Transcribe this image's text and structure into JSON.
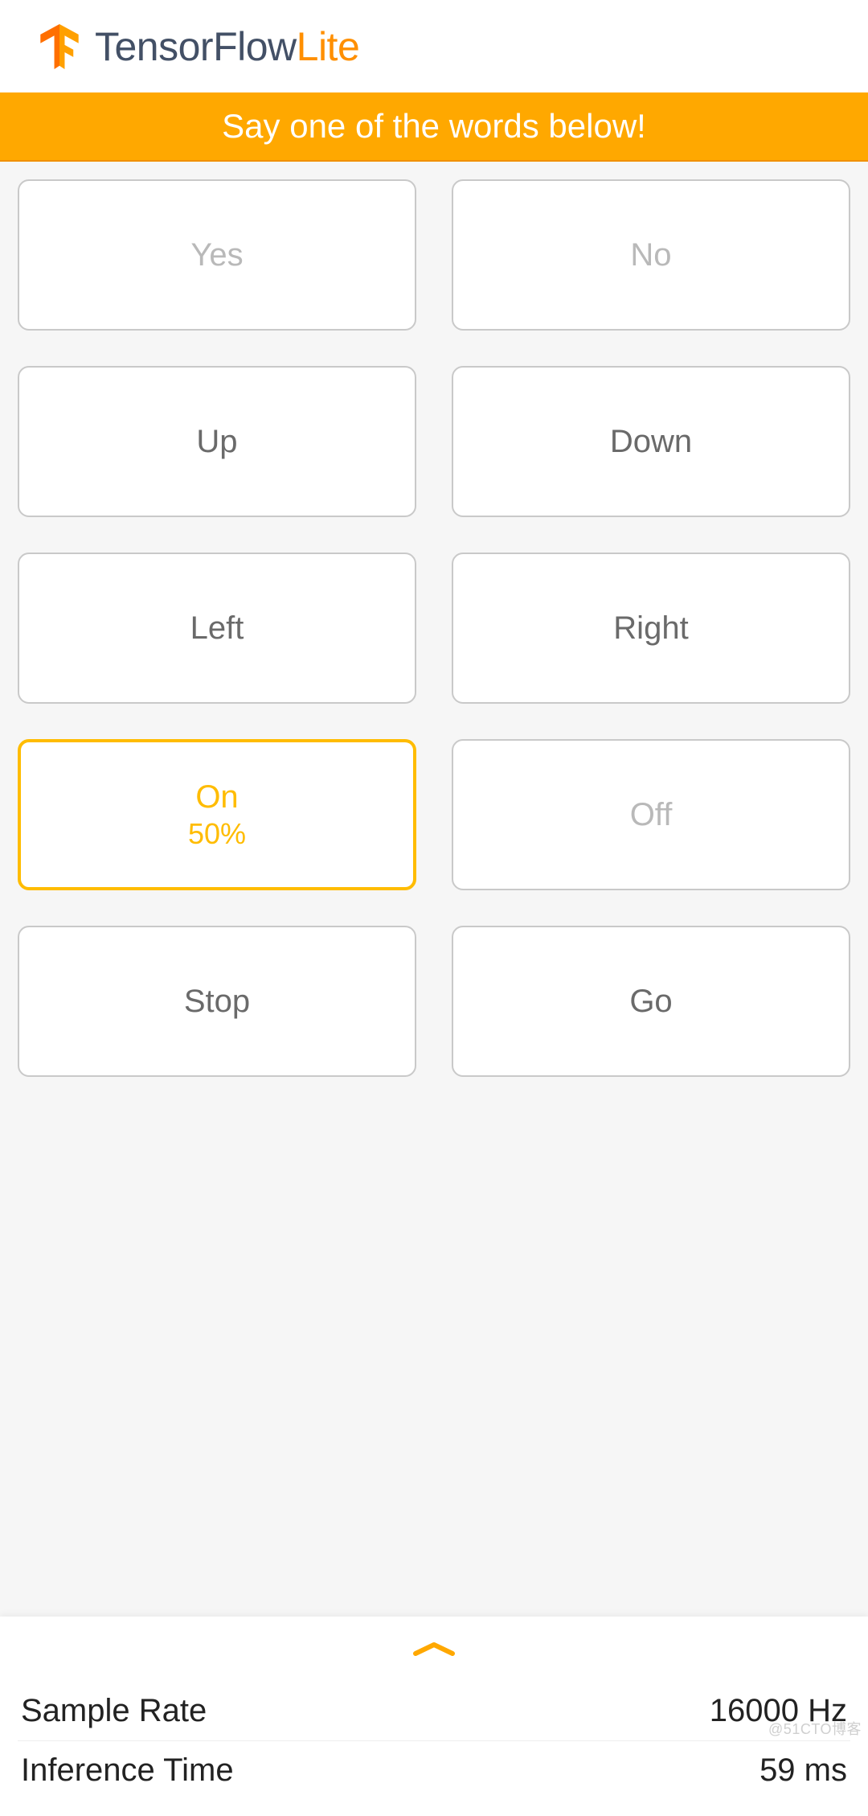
{
  "header": {
    "brand_main": "TensorFlow",
    "brand_sub": "Lite"
  },
  "banner": {
    "text": "Say one of the words below!"
  },
  "words": [
    {
      "label": "Yes",
      "highlighted": false,
      "dim": true,
      "confidence": null
    },
    {
      "label": "No",
      "highlighted": false,
      "dim": true,
      "confidence": null
    },
    {
      "label": "Up",
      "highlighted": false,
      "dim": false,
      "confidence": null
    },
    {
      "label": "Down",
      "highlighted": false,
      "dim": false,
      "confidence": null
    },
    {
      "label": "Left",
      "highlighted": false,
      "dim": false,
      "confidence": null
    },
    {
      "label": "Right",
      "highlighted": false,
      "dim": false,
      "confidence": null
    },
    {
      "label": "On",
      "highlighted": true,
      "dim": false,
      "confidence": "50%"
    },
    {
      "label": "Off",
      "highlighted": false,
      "dim": true,
      "confidence": null
    },
    {
      "label": "Stop",
      "highlighted": false,
      "dim": false,
      "confidence": null
    },
    {
      "label": "Go",
      "highlighted": false,
      "dim": false,
      "confidence": null
    }
  ],
  "stats": {
    "sample_rate_label": "Sample Rate",
    "sample_rate_value": "16000 Hz",
    "inference_time_label": "Inference Time",
    "inference_time_value": "59 ms"
  },
  "watermark": "@51CTO博客"
}
